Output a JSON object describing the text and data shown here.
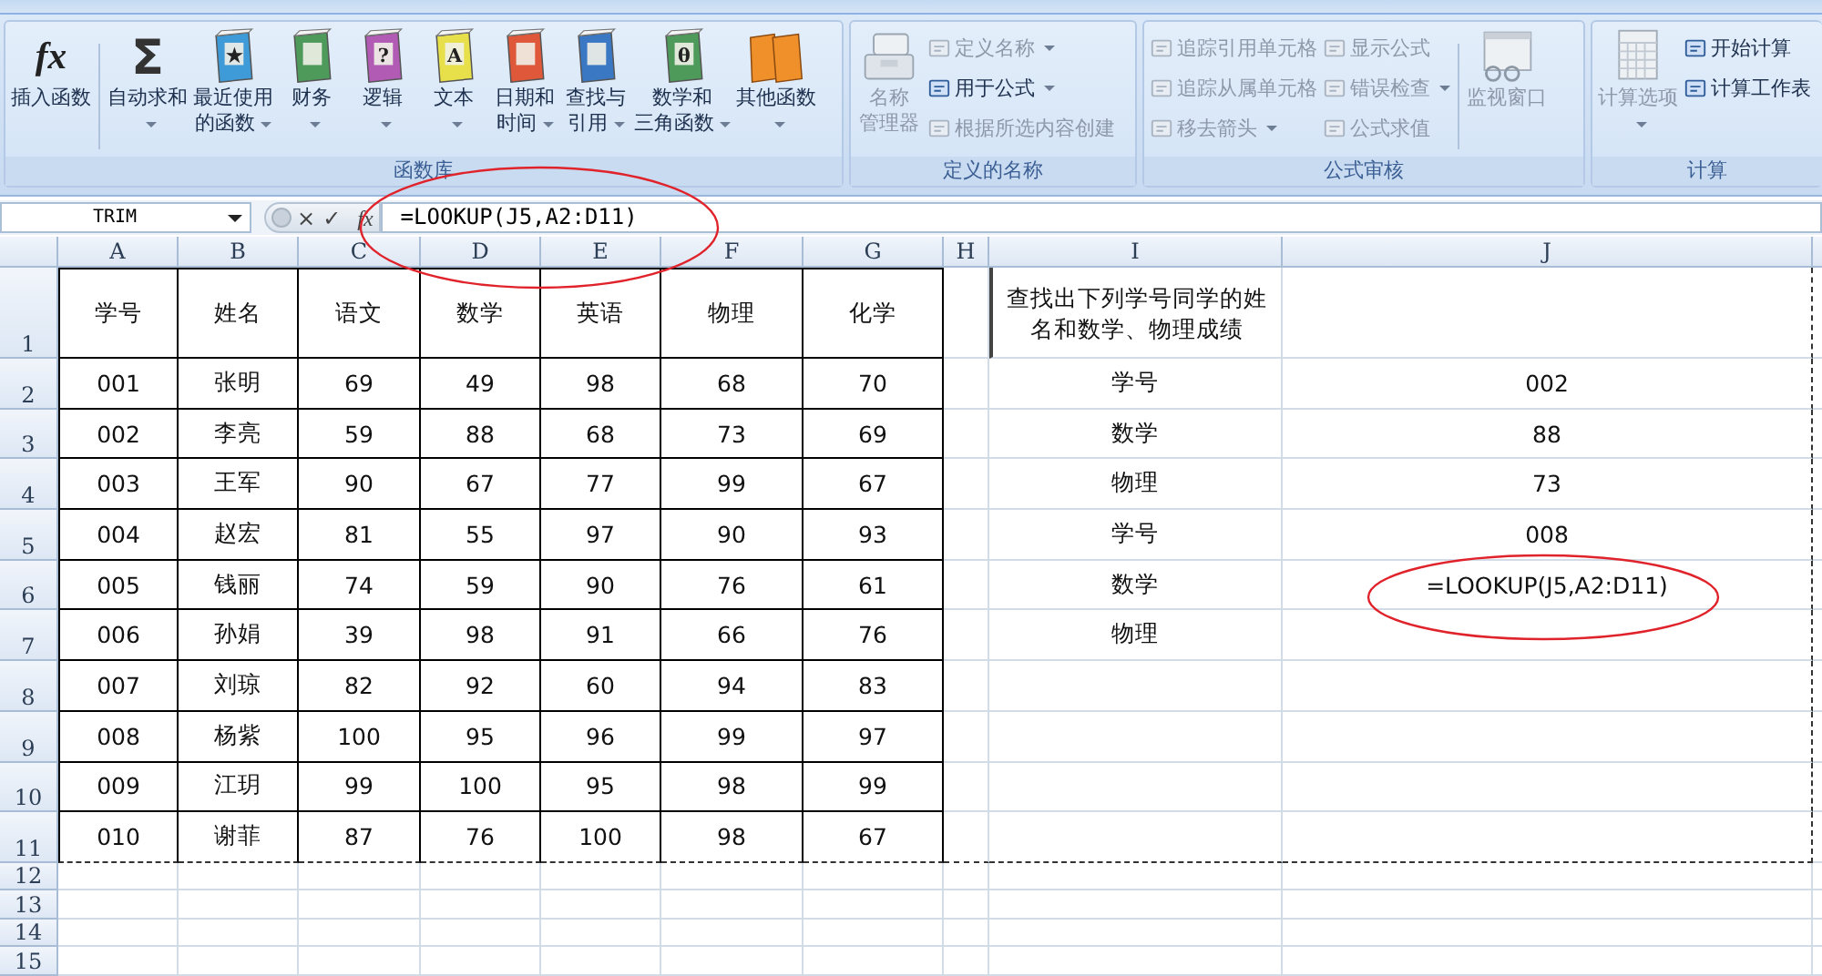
{
  "ribbon": {
    "groups": [
      {
        "label": "函数库",
        "items": [
          {
            "kind": "fx",
            "glyph": "fx",
            "lines": [
              "插入函数"
            ],
            "dropdown": false,
            "disabled": false,
            "separator_after": true
          },
          {
            "kind": "sigma",
            "glyph": "Σ",
            "lines": [
              "自动求和"
            ],
            "dropdown": true,
            "disabled": false
          },
          {
            "kind": "book",
            "color": "#3f9ad8",
            "glyph": "★",
            "lines": [
              "最近使用",
              "的函数"
            ],
            "dropdown": true,
            "disabled": false
          },
          {
            "kind": "book",
            "color": "#4e9a5a",
            "lines": [
              "财务"
            ],
            "dropdown": true,
            "disabled": false
          },
          {
            "kind": "book",
            "color": "#b25bb5",
            "glyph": "?",
            "lines": [
              "逻辑"
            ],
            "dropdown": true,
            "disabled": false
          },
          {
            "kind": "book",
            "color": "#e8e04a",
            "glyph": "A",
            "lines": [
              "文本"
            ],
            "dropdown": true,
            "disabled": false
          },
          {
            "kind": "book",
            "color": "#e0583a",
            "lines": [
              "日期和",
              "时间"
            ],
            "dropdown": true,
            "disabled": false
          },
          {
            "kind": "book",
            "color": "#3a78c4",
            "lines": [
              "查找与",
              "引用"
            ],
            "dropdown": true,
            "disabled": false
          },
          {
            "kind": "book",
            "color": "#4e9a5a",
            "glyph": "θ",
            "lines": [
              "数学和",
              "三角函数"
            ],
            "dropdown": true,
            "disabled": false
          },
          {
            "kind": "books",
            "color": "#f0902a",
            "lines": [
              "其他函数"
            ],
            "dropdown": true,
            "disabled": false
          }
        ]
      },
      {
        "label": "定义的名称",
        "items": [
          {
            "kind": "cards",
            "lines": [
              "名称",
              "管理器"
            ],
            "dropdown": false,
            "disabled": true
          },
          {
            "kind": "stack",
            "buttons": [
              {
                "label": "定义名称",
                "dropdown": true,
                "disabled": true
              },
              {
                "label": "用于公式",
                "dropdown": true,
                "disabled": false
              },
              {
                "label": "根据所选内容创建",
                "dropdown": false,
                "disabled": true
              }
            ]
          }
        ]
      },
      {
        "label": "公式审核",
        "items": [
          {
            "kind": "stack",
            "buttons": [
              {
                "label": "追踪引用单元格",
                "dropdown": false,
                "disabled": true
              },
              {
                "label": "追踪从属单元格",
                "dropdown": false,
                "disabled": true
              },
              {
                "label": "移去箭头",
                "dropdown": true,
                "disabled": true
              }
            ]
          },
          {
            "kind": "stack",
            "separator_after": true,
            "buttons": [
              {
                "label": "显示公式",
                "dropdown": false,
                "disabled": true
              },
              {
                "label": "错误检查",
                "dropdown": true,
                "disabled": true
              },
              {
                "label": "公式求值",
                "dropdown": false,
                "disabled": true
              }
            ]
          },
          {
            "kind": "window",
            "lines": [
              "监视窗口"
            ],
            "dropdown": false,
            "disabled": true
          }
        ]
      },
      {
        "label": "计算",
        "items": [
          {
            "kind": "calculator",
            "lines": [
              "计算选项"
            ],
            "dropdown": true,
            "disabled": true
          },
          {
            "kind": "stack",
            "buttons": [
              {
                "label": "开始计算",
                "dropdown": false,
                "disabled": false
              },
              {
                "label": "计算工作表",
                "dropdown": false,
                "disabled": false
              }
            ]
          }
        ]
      }
    ]
  },
  "formula_bar": {
    "name_box": "TRIM",
    "cancel": "×",
    "enter": "✓",
    "insert_function": "fx",
    "formula": "=LOOKUP(J5,A2:D11)",
    "circled": true
  },
  "sheet": {
    "columns": [
      {
        "letter": "A",
        "bordered": true
      },
      {
        "letter": "B",
        "bordered": true
      },
      {
        "letter": "C",
        "bordered": true
      },
      {
        "letter": "D",
        "bordered": true
      },
      {
        "letter": "E",
        "bordered": true
      },
      {
        "letter": "F",
        "bordered": true
      },
      {
        "letter": "G",
        "bordered": true
      },
      {
        "letter": "H",
        "bordered": false
      },
      {
        "letter": "I",
        "bordered": false
      },
      {
        "letter": "J",
        "bordered": false
      }
    ],
    "rows": [
      {
        "num": "1",
        "cells": [
          "学号",
          "姓名",
          "语文",
          "数学",
          "英语",
          "物理",
          "化学",
          null,
          "查找出下列学号同学的姓名和数学、物理成绩",
          null
        ]
      },
      {
        "num": "2",
        "cells": [
          "001",
          "张明",
          "69",
          "49",
          "98",
          "68",
          "70",
          null,
          "学号",
          "002"
        ]
      },
      {
        "num": "3",
        "cells": [
          "002",
          "李亮",
          "59",
          "88",
          "68",
          "73",
          "69",
          null,
          "数学",
          "88"
        ]
      },
      {
        "num": "4",
        "cells": [
          "003",
          "王军",
          "90",
          "67",
          "77",
          "99",
          "67",
          null,
          "物理",
          "73"
        ]
      },
      {
        "num": "5",
        "cells": [
          "004",
          "赵宏",
          "81",
          "55",
          "97",
          "90",
          "93",
          null,
          "学号",
          "008"
        ]
      },
      {
        "num": "6",
        "cells": [
          "005",
          "钱丽",
          "74",
          "59",
          "90",
          "76",
          "61",
          null,
          "数学",
          {
            "text": "=LOOKUP(J5,A2:D11)",
            "circled": true
          }
        ]
      },
      {
        "num": "7",
        "cells": [
          "006",
          "孙娟",
          "39",
          "98",
          "91",
          "66",
          "76",
          null,
          "物理",
          null
        ]
      },
      {
        "num": "8",
        "cells": [
          "007",
          "刘琼",
          "82",
          "92",
          "60",
          "94",
          "83",
          null,
          null,
          null
        ]
      },
      {
        "num": "9",
        "cells": [
          "008",
          "杨紫",
          "100",
          "95",
          "96",
          "99",
          "97",
          null,
          null,
          null
        ]
      },
      {
        "num": "10",
        "cells": [
          "009",
          "江玥",
          "99",
          "100",
          "95",
          "98",
          "99",
          null,
          null,
          null
        ]
      },
      {
        "num": "11",
        "cells": [
          "010",
          "谢菲",
          "87",
          "76",
          "100",
          "98",
          "67",
          null,
          null,
          null
        ]
      },
      {
        "num": "12"
      },
      {
        "num": "13"
      },
      {
        "num": "14"
      },
      {
        "num": "15"
      }
    ]
  }
}
